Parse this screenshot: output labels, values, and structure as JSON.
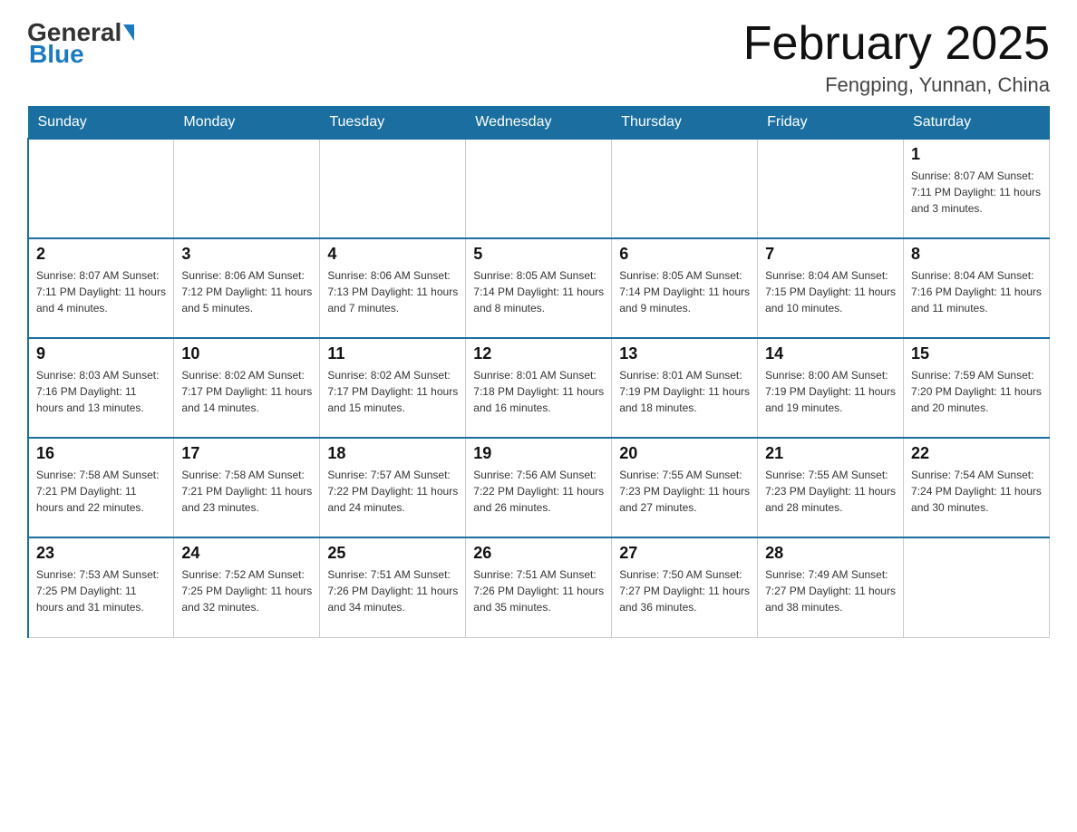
{
  "header": {
    "logo_general": "General",
    "logo_blue": "Blue",
    "title": "February 2025",
    "location": "Fengping, Yunnan, China"
  },
  "days_of_week": [
    "Sunday",
    "Monday",
    "Tuesday",
    "Wednesday",
    "Thursday",
    "Friday",
    "Saturday"
  ],
  "weeks": [
    [
      {
        "day": "",
        "info": "",
        "empty": true
      },
      {
        "day": "",
        "info": "",
        "empty": true
      },
      {
        "day": "",
        "info": "",
        "empty": true
      },
      {
        "day": "",
        "info": "",
        "empty": true
      },
      {
        "day": "",
        "info": "",
        "empty": true
      },
      {
        "day": "",
        "info": "",
        "empty": true
      },
      {
        "day": "1",
        "info": "Sunrise: 8:07 AM\nSunset: 7:11 PM\nDaylight: 11 hours and 3 minutes.",
        "empty": false
      }
    ],
    [
      {
        "day": "2",
        "info": "Sunrise: 8:07 AM\nSunset: 7:11 PM\nDaylight: 11 hours and 4 minutes.",
        "empty": false
      },
      {
        "day": "3",
        "info": "Sunrise: 8:06 AM\nSunset: 7:12 PM\nDaylight: 11 hours and 5 minutes.",
        "empty": false
      },
      {
        "day": "4",
        "info": "Sunrise: 8:06 AM\nSunset: 7:13 PM\nDaylight: 11 hours and 7 minutes.",
        "empty": false
      },
      {
        "day": "5",
        "info": "Sunrise: 8:05 AM\nSunset: 7:14 PM\nDaylight: 11 hours and 8 minutes.",
        "empty": false
      },
      {
        "day": "6",
        "info": "Sunrise: 8:05 AM\nSunset: 7:14 PM\nDaylight: 11 hours and 9 minutes.",
        "empty": false
      },
      {
        "day": "7",
        "info": "Sunrise: 8:04 AM\nSunset: 7:15 PM\nDaylight: 11 hours and 10 minutes.",
        "empty": false
      },
      {
        "day": "8",
        "info": "Sunrise: 8:04 AM\nSunset: 7:16 PM\nDaylight: 11 hours and 11 minutes.",
        "empty": false
      }
    ],
    [
      {
        "day": "9",
        "info": "Sunrise: 8:03 AM\nSunset: 7:16 PM\nDaylight: 11 hours and 13 minutes.",
        "empty": false
      },
      {
        "day": "10",
        "info": "Sunrise: 8:02 AM\nSunset: 7:17 PM\nDaylight: 11 hours and 14 minutes.",
        "empty": false
      },
      {
        "day": "11",
        "info": "Sunrise: 8:02 AM\nSunset: 7:17 PM\nDaylight: 11 hours and 15 minutes.",
        "empty": false
      },
      {
        "day": "12",
        "info": "Sunrise: 8:01 AM\nSunset: 7:18 PM\nDaylight: 11 hours and 16 minutes.",
        "empty": false
      },
      {
        "day": "13",
        "info": "Sunrise: 8:01 AM\nSunset: 7:19 PM\nDaylight: 11 hours and 18 minutes.",
        "empty": false
      },
      {
        "day": "14",
        "info": "Sunrise: 8:00 AM\nSunset: 7:19 PM\nDaylight: 11 hours and 19 minutes.",
        "empty": false
      },
      {
        "day": "15",
        "info": "Sunrise: 7:59 AM\nSunset: 7:20 PM\nDaylight: 11 hours and 20 minutes.",
        "empty": false
      }
    ],
    [
      {
        "day": "16",
        "info": "Sunrise: 7:58 AM\nSunset: 7:21 PM\nDaylight: 11 hours and 22 minutes.",
        "empty": false
      },
      {
        "day": "17",
        "info": "Sunrise: 7:58 AM\nSunset: 7:21 PM\nDaylight: 11 hours and 23 minutes.",
        "empty": false
      },
      {
        "day": "18",
        "info": "Sunrise: 7:57 AM\nSunset: 7:22 PM\nDaylight: 11 hours and 24 minutes.",
        "empty": false
      },
      {
        "day": "19",
        "info": "Sunrise: 7:56 AM\nSunset: 7:22 PM\nDaylight: 11 hours and 26 minutes.",
        "empty": false
      },
      {
        "day": "20",
        "info": "Sunrise: 7:55 AM\nSunset: 7:23 PM\nDaylight: 11 hours and 27 minutes.",
        "empty": false
      },
      {
        "day": "21",
        "info": "Sunrise: 7:55 AM\nSunset: 7:23 PM\nDaylight: 11 hours and 28 minutes.",
        "empty": false
      },
      {
        "day": "22",
        "info": "Sunrise: 7:54 AM\nSunset: 7:24 PM\nDaylight: 11 hours and 30 minutes.",
        "empty": false
      }
    ],
    [
      {
        "day": "23",
        "info": "Sunrise: 7:53 AM\nSunset: 7:25 PM\nDaylight: 11 hours and 31 minutes.",
        "empty": false
      },
      {
        "day": "24",
        "info": "Sunrise: 7:52 AM\nSunset: 7:25 PM\nDaylight: 11 hours and 32 minutes.",
        "empty": false
      },
      {
        "day": "25",
        "info": "Sunrise: 7:51 AM\nSunset: 7:26 PM\nDaylight: 11 hours and 34 minutes.",
        "empty": false
      },
      {
        "day": "26",
        "info": "Sunrise: 7:51 AM\nSunset: 7:26 PM\nDaylight: 11 hours and 35 minutes.",
        "empty": false
      },
      {
        "day": "27",
        "info": "Sunrise: 7:50 AM\nSunset: 7:27 PM\nDaylight: 11 hours and 36 minutes.",
        "empty": false
      },
      {
        "day": "28",
        "info": "Sunrise: 7:49 AM\nSunset: 7:27 PM\nDaylight: 11 hours and 38 minutes.",
        "empty": false
      },
      {
        "day": "",
        "info": "",
        "empty": true
      }
    ]
  ]
}
